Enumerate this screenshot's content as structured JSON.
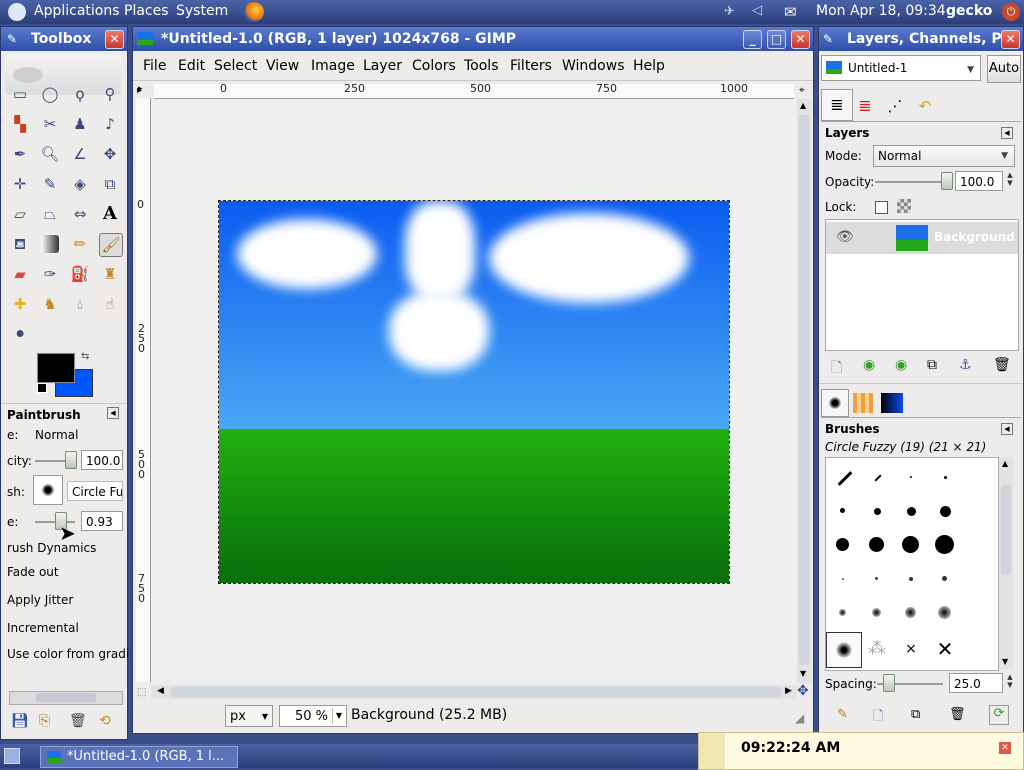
{
  "top_panel": {
    "menus": [
      "Applications",
      "Places",
      "System"
    ],
    "clock": "Mon Apr 18, 09:34",
    "user": "gecko"
  },
  "toolbox": {
    "title": "Toolbox",
    "tool_options": {
      "title": "Paintbrush",
      "mode_label": "e:",
      "mode_value": "Normal",
      "opacity_label": "city:",
      "opacity_value": "100.0",
      "opacity_level": 1.0,
      "brush_label": "sh:",
      "brush_value": "Circle Fuz",
      "scale_label": "e:",
      "scale_value": "0.93",
      "dynamics_label": "rush Dynamics",
      "options": [
        "Fade out",
        "Apply Jitter",
        "Incremental",
        "Use color from gradi"
      ]
    },
    "colors": {
      "fg": "#000000",
      "bg": "#0055ff"
    }
  },
  "image_window": {
    "title": "*Untitled-1.0 (RGB, 1 layer) 1024x768 - GIMP",
    "menu": [
      "File",
      "Edit",
      "Select",
      "View",
      "Image",
      "Layer",
      "Colors",
      "Tools",
      "Filters",
      "Windows",
      "Help"
    ],
    "ruler_h": [
      "0",
      "250",
      "500",
      "750",
      "1000"
    ],
    "ruler_v": [
      "0",
      "250",
      "500",
      "750"
    ],
    "unit": "px",
    "zoom": "50 %",
    "status": "Background (25.2 MB)",
    "canvas_colors": {
      "sky_top": "#0a5cf0",
      "sky_bottom": "#4aa8f4",
      "grass_top": "#20b010",
      "grass_bottom": "#0a6e0a"
    }
  },
  "layers_dialog": {
    "title": "Layers, Channels, P",
    "image_select": "Untitled-1",
    "auto_label": "Auto",
    "section": "Layers",
    "mode_label": "Mode:",
    "mode_value": "Normal",
    "opacity_label": "Opacity:",
    "opacity_value": "100.0",
    "opacity_level": 1.0,
    "lock_label": "Lock:",
    "layer_name": "Background"
  },
  "brushes_dialog": {
    "title": "Brushes",
    "current": "Circle Fuzzy (19) (21 × 21)",
    "spacing_label": "Spacing:",
    "spacing_value": "25.0",
    "spacing_level": 0.25
  },
  "taskbar": {
    "task": "*Untitled-1.0 (RGB, 1 l...",
    "time": "09:22:24 AM"
  }
}
